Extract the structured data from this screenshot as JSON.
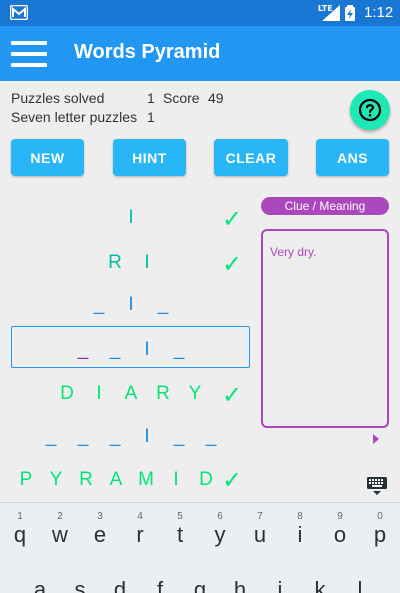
{
  "statusbar": {
    "network": "LTE",
    "time": "1:12"
  },
  "appbar": {
    "title": "Words Pyramid"
  },
  "stats": {
    "puzzles_solved_label": "Puzzles solved",
    "puzzles_solved_value": "1",
    "score_label": "Score",
    "score_value": "49",
    "seven_letter_label": "Seven letter puzzles",
    "seven_letter_value": "1"
  },
  "buttons": {
    "new": "NEW",
    "hint": "HINT",
    "clear": "CLEAR",
    "ans": "ANS"
  },
  "pyramid": {
    "row1": [
      "I"
    ],
    "row2": [
      "R",
      "I"
    ],
    "row3": [
      "_",
      "I",
      "_"
    ],
    "row4": [
      "_",
      "_",
      "I",
      "_"
    ],
    "row5": [
      "D",
      "I",
      "A",
      "R",
      "Y"
    ],
    "row6": [
      "_",
      "_",
      "_",
      "I",
      "_",
      "_"
    ],
    "row7": [
      "P",
      "Y",
      "R",
      "A",
      "M",
      "I",
      "D"
    ],
    "check": "✓"
  },
  "clue": {
    "label": "Clue / Meaning",
    "text": "Very dry."
  },
  "keyboard": {
    "row1": [
      {
        "hint": "1",
        "letter": "q"
      },
      {
        "hint": "2",
        "letter": "w"
      },
      {
        "hint": "3",
        "letter": "e"
      },
      {
        "hint": "4",
        "letter": "r"
      },
      {
        "hint": "5",
        "letter": "t"
      },
      {
        "hint": "6",
        "letter": "y"
      },
      {
        "hint": "7",
        "letter": "u"
      },
      {
        "hint": "8",
        "letter": "i"
      },
      {
        "hint": "9",
        "letter": "o"
      },
      {
        "hint": "0",
        "letter": "p"
      }
    ],
    "row2": [
      "a",
      "s",
      "d",
      "f",
      "g",
      "h",
      "j",
      "k",
      "l"
    ]
  },
  "colors": {
    "appbar": "#2196f3",
    "statusbar": "#1976d2",
    "button": "#29b6f6",
    "accent": "#ab47bc",
    "solved": "#00e676"
  }
}
